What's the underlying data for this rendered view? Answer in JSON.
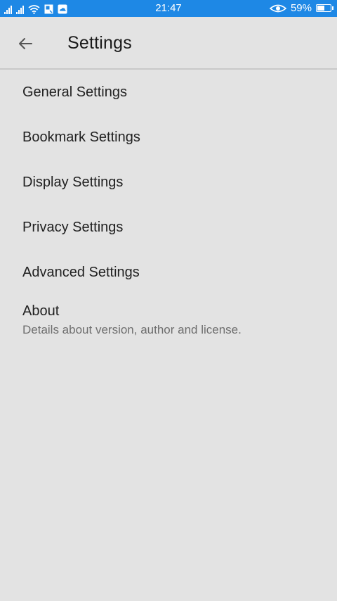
{
  "status_bar": {
    "time": "21:47",
    "battery_percent_text": "59%",
    "battery_level": 0.59,
    "icons": [
      "signal-icon",
      "signal-icon",
      "wifi-icon",
      "notification-icon",
      "cloud-icon",
      "eye-icon",
      "battery-icon"
    ],
    "background_color": "#1e88e5"
  },
  "toolbar": {
    "title": "Settings",
    "back_icon": "arrow-left-icon"
  },
  "settings": {
    "items": [
      {
        "label": "General Settings"
      },
      {
        "label": "Bookmark Settings"
      },
      {
        "label": "Display Settings"
      },
      {
        "label": "Privacy Settings"
      },
      {
        "label": "Advanced Settings"
      }
    ],
    "about": {
      "title": "About",
      "summary": "Details about version, author and license."
    }
  },
  "colors": {
    "background": "#e3e3e3",
    "text_primary": "#212121",
    "text_secondary": "#6e6e6e"
  }
}
